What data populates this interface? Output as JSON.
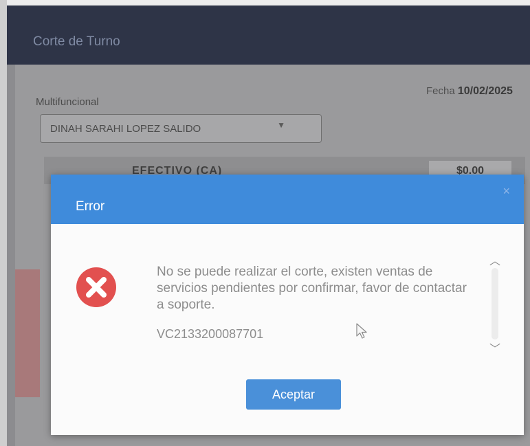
{
  "window": {
    "title": "Corte de Turno"
  },
  "form": {
    "section_label": "Multifuncional",
    "fecha_label": "Fecha",
    "fecha_value": "10/02/2025",
    "user_selected": "DINAH SARAHI LOPEZ SALIDO",
    "payment_label": "EFECTIVO (CA)",
    "payment_amount": "$0.00"
  },
  "dialog": {
    "title": "Error",
    "close_glyph": "×",
    "message": "No se puede realizar el corte, existen ventas de servicios pendientes por confirmar, favor de contactar a soporte.",
    "code": "VC2133200087701",
    "accept_label": "Aceptar"
  },
  "colors": {
    "header_blue": "#3f8bdb",
    "button_blue": "#4a90d9",
    "error_red": "#e2504f",
    "title_bar": "#2e3447"
  },
  "icons": {
    "error": "error-x-circle-icon",
    "close": "close-icon",
    "select": "chevron-down-icon",
    "scroll_up": "chevron-up-icon",
    "scroll_down": "chevron-down-icon",
    "cursor": "mouse-pointer-icon"
  }
}
